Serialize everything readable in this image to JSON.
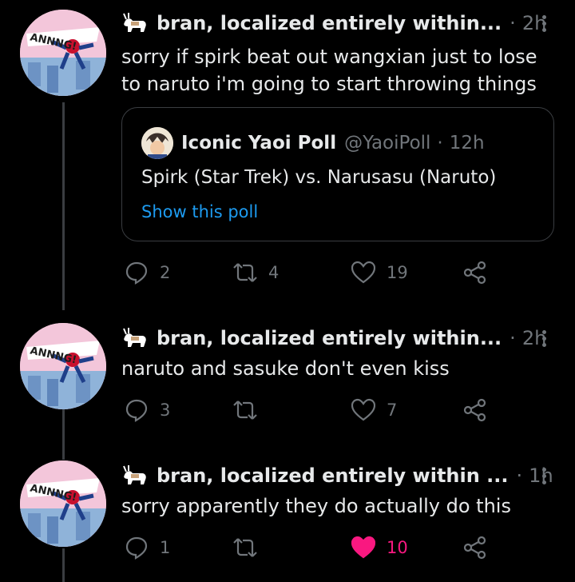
{
  "colors": {
    "background": "#000000",
    "text": "#e7e9ea",
    "muted": "#71767b",
    "link": "#1d9bf0",
    "like": "#f91880",
    "border": "#3a3d41"
  },
  "tweets": [
    {
      "author": "bran, localized entirely within...",
      "separator": "·",
      "time": "2h",
      "text": "sorry if spirk beat out wangxian just to lose to naruto i'm going to start throwing things",
      "quote": {
        "name": "Iconic Yaoi Poll",
        "handle": "@YaoiPoll",
        "separator": "·",
        "time": "12h",
        "text": "Spirk (Star Trek) vs. Narusasu (Naruto)",
        "link": "Show this poll"
      },
      "replies": "2",
      "retweets": "4",
      "likes": "19",
      "liked": false
    },
    {
      "author": "bran, localized entirely within...",
      "separator": "·",
      "time": "2h",
      "text": "naruto and sasuke don't even kiss",
      "replies": "3",
      "retweets": "",
      "likes": "7",
      "liked": false
    },
    {
      "author": "bran, localized entirely within ...",
      "separator": "·",
      "time": "1h",
      "text": "sorry apparently they do actually do this",
      "replies": "1",
      "retweets": "",
      "likes": "10",
      "liked": true
    }
  ],
  "icons": {
    "reply": "reply-icon",
    "retweet": "retweet-icon",
    "like": "heart-icon",
    "share": "share-icon",
    "more": "more-icon",
    "goat": "goat-icon"
  }
}
